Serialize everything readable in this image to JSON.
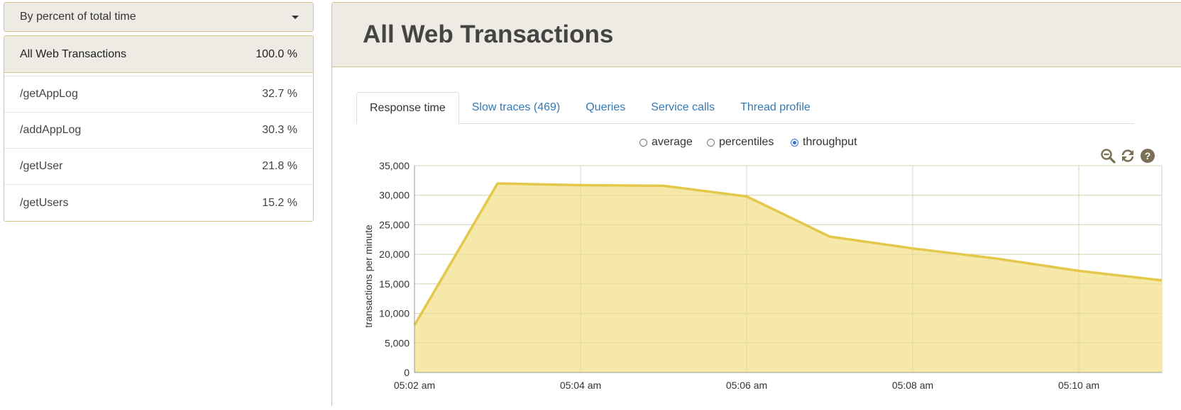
{
  "sidebar": {
    "sort_label": "By percent of total time",
    "total": {
      "name": "All Web Transactions",
      "percent": "100.0 %"
    },
    "items": [
      {
        "name": "/getAppLog",
        "percent": "32.7 %"
      },
      {
        "name": "/addAppLog",
        "percent": "30.3 %"
      },
      {
        "name": "/getUser",
        "percent": "21.8 %"
      },
      {
        "name": "/getUsers",
        "percent": "15.2 %"
      }
    ]
  },
  "main": {
    "title": "All Web Transactions",
    "tabs": [
      {
        "label": "Response time",
        "active": true
      },
      {
        "label": "Slow traces (469)",
        "active": false
      },
      {
        "label": "Queries",
        "active": false
      },
      {
        "label": "Service calls",
        "active": false
      },
      {
        "label": "Thread profile",
        "active": false
      }
    ],
    "view_options": [
      {
        "label": "average",
        "checked": false
      },
      {
        "label": "percentiles",
        "checked": false
      },
      {
        "label": "throughput",
        "checked": true
      }
    ],
    "tools": [
      "zoom-out-icon",
      "refresh-icon",
      "help-icon"
    ]
  },
  "colors": {
    "accent_border": "#d4c487",
    "header_bg": "#eeebe5",
    "link": "#337ab7",
    "series_fill": "#f5e7a3",
    "series_line": "#e3c84b"
  },
  "chart_data": {
    "type": "area",
    "ylabel": "transactions per minute",
    "xlabel": "",
    "title": "",
    "ylim": [
      0,
      35000
    ],
    "yticks": [
      "0",
      "5,000",
      "10,000",
      "15,000",
      "20,000",
      "25,000",
      "30,000",
      "35,000"
    ],
    "ytick_values": [
      0,
      5000,
      10000,
      15000,
      20000,
      25000,
      30000,
      35000
    ],
    "xticks": [
      "05:02 am",
      "05:04 am",
      "05:06 am",
      "05:08 am",
      "05:10 am"
    ],
    "xtick_values": [
      "05:02",
      "05:04",
      "05:06",
      "05:08",
      "05:10"
    ],
    "xlim": [
      "05:02",
      "05:11"
    ],
    "grid": true,
    "series": [
      {
        "x": [
          "05:02",
          "05:03",
          "05:04",
          "05:05",
          "05:06",
          "05:07",
          "05:08",
          "05:09",
          "05:10",
          "05:11"
        ],
        "values": [
          8000,
          32000,
          31700,
          31600,
          29800,
          23000,
          21000,
          19300,
          17200,
          15600
        ]
      }
    ]
  }
}
